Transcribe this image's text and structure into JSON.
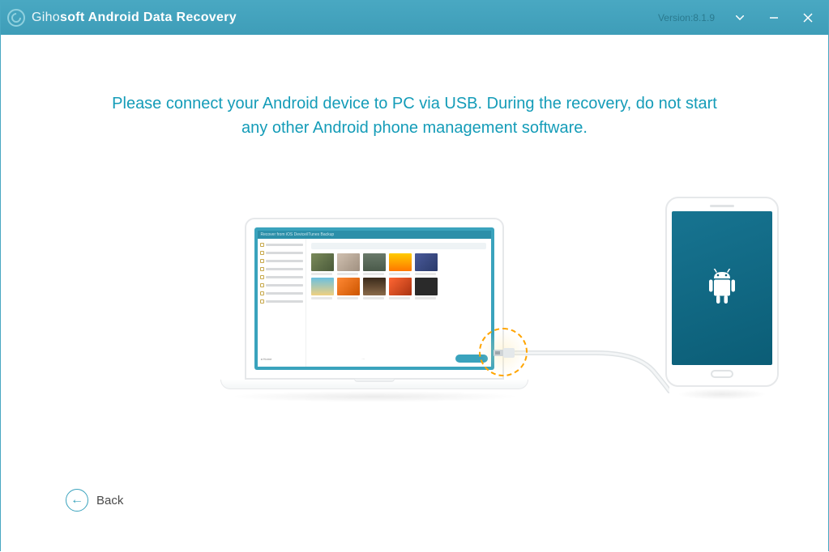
{
  "header": {
    "brand_prefix": "Giho",
    "brand_suffix": "soft",
    "product_name": " Android Data Recovery",
    "version_label": "Version:8.1.9"
  },
  "main": {
    "instruction": "Please connect your Android device to PC via USB. During the recovery, do not start any other Android phone management software.",
    "laptop_screen_title": "Recover from iOS Device/iTunes Backup"
  },
  "footer": {
    "back_label": "Back"
  },
  "icons": {
    "dropdown": "chevron-down-icon",
    "minimize": "minimize-icon",
    "close": "close-icon",
    "back": "arrow-left-icon",
    "android": "android-robot-icon",
    "usb": "usb-plug-icon"
  }
}
